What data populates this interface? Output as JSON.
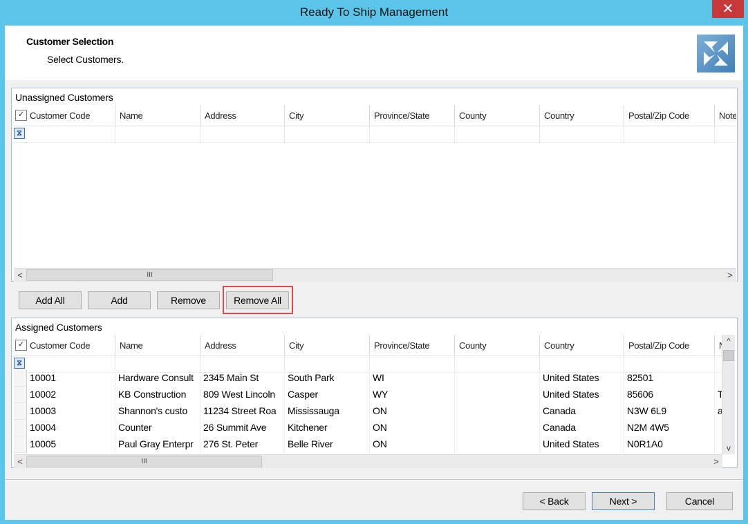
{
  "window": {
    "title": "Ready To Ship Management",
    "close_glyph": "✕"
  },
  "header": {
    "title": "Customer Selection",
    "subtitle": "Select Customers.",
    "logo_icon": "app-logo-icon"
  },
  "columns": [
    "Customer Code",
    "Name",
    "Address",
    "City",
    "Province/State",
    "County",
    "Country",
    "Postal/Zip Code",
    "Notes"
  ],
  "unassigned": {
    "title": "Unassigned Customers",
    "columns_visible": [
      "Customer Code",
      "Name",
      "Address",
      "City",
      "Province/State",
      "County",
      "Country",
      "Postal/Zip Code",
      "Note"
    ],
    "rows": []
  },
  "assigned": {
    "title": "Assigned Customers",
    "columns_visible": [
      "Customer Code",
      "Name",
      "Address",
      "City",
      "Province/State",
      "County",
      "Country",
      "Postal/Zip Code",
      "N"
    ],
    "rows": [
      {
        "code": "10001",
        "name": "Hardware Consult",
        "address": "2345 Main St",
        "city": "South Park",
        "province": "WI",
        "county": "",
        "country": "United States",
        "postal": "82501",
        "notes": ""
      },
      {
        "code": "10002",
        "name": "KB Construction",
        "address": "809 West Lincoln",
        "city": "Casper",
        "province": "WY",
        "county": "",
        "country": "United States",
        "postal": "85606",
        "notes": "T"
      },
      {
        "code": "10003",
        "name": "Shannon's custo",
        "address": "11234 Street Roa",
        "city": "Mississauga",
        "province": "ON",
        "county": "",
        "country": "Canada",
        "postal": "N3W 6L9",
        "notes": "a"
      },
      {
        "code": "10004",
        "name": "Counter",
        "address": "26 Summit Ave",
        "city": "Kitchener",
        "province": "ON",
        "county": "",
        "country": "Canada",
        "postal": "N2M 4W5",
        "notes": ""
      },
      {
        "code": "10005",
        "name": "Paul Gray Enterpr",
        "address": "276 St. Peter",
        "city": "Belle River",
        "province": "ON",
        "county": "",
        "country": "United States",
        "postal": "N0R1A0",
        "notes": ""
      }
    ]
  },
  "buttons": {
    "add_all": "Add All",
    "add": "Add",
    "remove": "Remove",
    "remove_all": "Remove All"
  },
  "footer": {
    "back": "< Back",
    "next": "Next >",
    "cancel": "Cancel"
  },
  "scroll": {
    "left": "<",
    "right": ">",
    "up": "^",
    "down": "v",
    "grip": "III"
  },
  "colors": {
    "accent": "#5bc6ea",
    "close": "#c7383a",
    "highlight": "#e04a4a"
  }
}
